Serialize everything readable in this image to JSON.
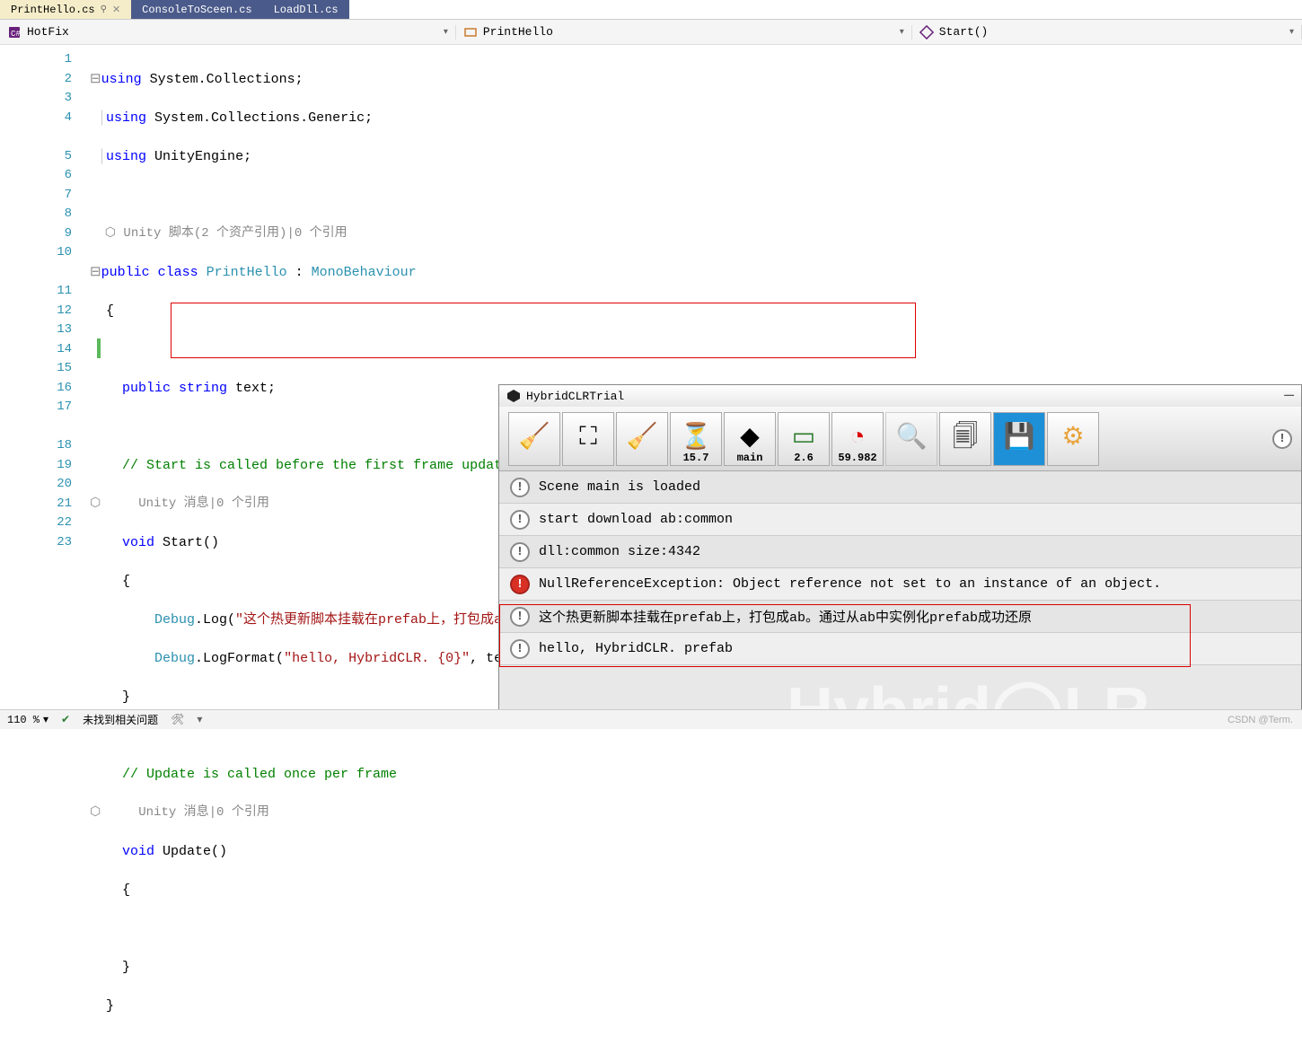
{
  "tabs": [
    {
      "label": "PrintHello.cs",
      "active": true,
      "pinned": true,
      "close": true
    },
    {
      "label": "ConsoleToSceen.cs",
      "active": false
    },
    {
      "label": "LoadDll.cs",
      "active": false
    }
  ],
  "breadcrumb": {
    "project": "HotFix",
    "class": "PrintHello",
    "member": "Start()"
  },
  "line_numbers": [
    "1",
    "2",
    "3",
    "4",
    "5",
    "6",
    "7",
    "8",
    "9",
    "10",
    "11",
    "12",
    "13",
    "14",
    "15",
    "16",
    "17",
    "18",
    "19",
    "20",
    "21",
    "22",
    "23"
  ],
  "code": {
    "l1a": "using",
    "l1b": " System.Collections;",
    "l2a": "using",
    "l2b": " System.Collections.Generic;",
    "l3a": "using",
    "l3b": " UnityEngine;",
    "ref1": " Unity 脚本(2 个资产引用)|0 个引用",
    "l5a": "public class ",
    "l5b": "PrintHello",
    "l5c": " : ",
    "l5d": "MonoBehaviour",
    "l6": "{",
    "l8a": "    public string",
    "l8b": " text;",
    "l10": "    // Start is called before the first frame update",
    "ref2": "     Unity 消息|0 个引用",
    "l11a": "    void ",
    "l11b": "Start",
    "l11c": "()",
    "l12": "    {",
    "l13a": "        Debug",
    "l13b": ".Log(",
    "l13c": "\"这个热更新脚本挂载在prefab上，打包成ab。通过从ab中实例化prefab成功还原\"",
    "l13d": ");",
    "l14a": "        Debug",
    "l14b": ".LogFormat(",
    "l14c": "\"hello, HybridCLR. {0}\"",
    "l14d": ", text);",
    "l15": "    }",
    "l17": "    // Update is called once per frame",
    "ref3": "     Unity 消息|0 个引用",
    "l18a": "    void ",
    "l18b": "Update",
    "l18c": "()",
    "l19": "    {",
    "l21": "    }",
    "l22": "}"
  },
  "unity": {
    "title": "HybridCLRTrial",
    "tool_labels": {
      "fps": "15.7",
      "scene": "main",
      "mem": "2.6",
      "rate": "59.982"
    },
    "logs": [
      {
        "type": "info",
        "text": "Scene main is loaded"
      },
      {
        "type": "info",
        "text": "start download ab:common"
      },
      {
        "type": "info",
        "text": "dll:common  size:4342"
      },
      {
        "type": "error",
        "text": "NullReferenceException: Object reference not set to an instance of an object."
      },
      {
        "type": "info",
        "text": "这个热更新脚本挂载在prefab上，打包成ab。通过从ab中实例化prefab成功还原"
      },
      {
        "type": "info",
        "text": "hello, HybridCLR. prefab"
      }
    ]
  },
  "status": {
    "zoom": "110 %",
    "issues": "未找到相关问题",
    "watermark": "CSDN @Term."
  }
}
